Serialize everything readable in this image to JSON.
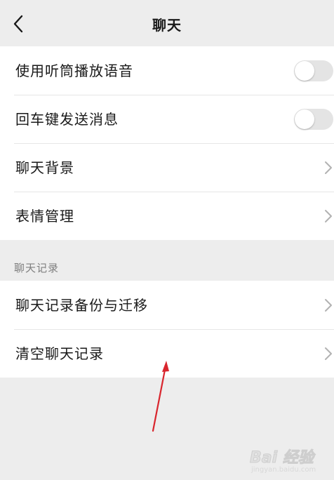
{
  "nav": {
    "title": "聊天"
  },
  "group1": [
    {
      "label": "使用听筒播放语音",
      "control": "toggle",
      "on": false
    },
    {
      "label": "回车键发送消息",
      "control": "toggle",
      "on": false
    },
    {
      "label": "聊天背景",
      "control": "chevron"
    },
    {
      "label": "表情管理",
      "control": "chevron"
    }
  ],
  "section_header": "聊天记录",
  "group2": [
    {
      "label": "聊天记录备份与迁移",
      "control": "chevron"
    },
    {
      "label": "清空聊天记录",
      "control": "chevron"
    }
  ],
  "watermark": {
    "brand": "Bai 经验",
    "url": "jingyan.baidu.com"
  },
  "colors": {
    "background": "#ededed",
    "row_background": "#ffffff",
    "annotation_arrow": "#d9262e"
  },
  "icons": {
    "back": "chevron-left-icon",
    "row_arrow": "chevron-right-icon"
  }
}
